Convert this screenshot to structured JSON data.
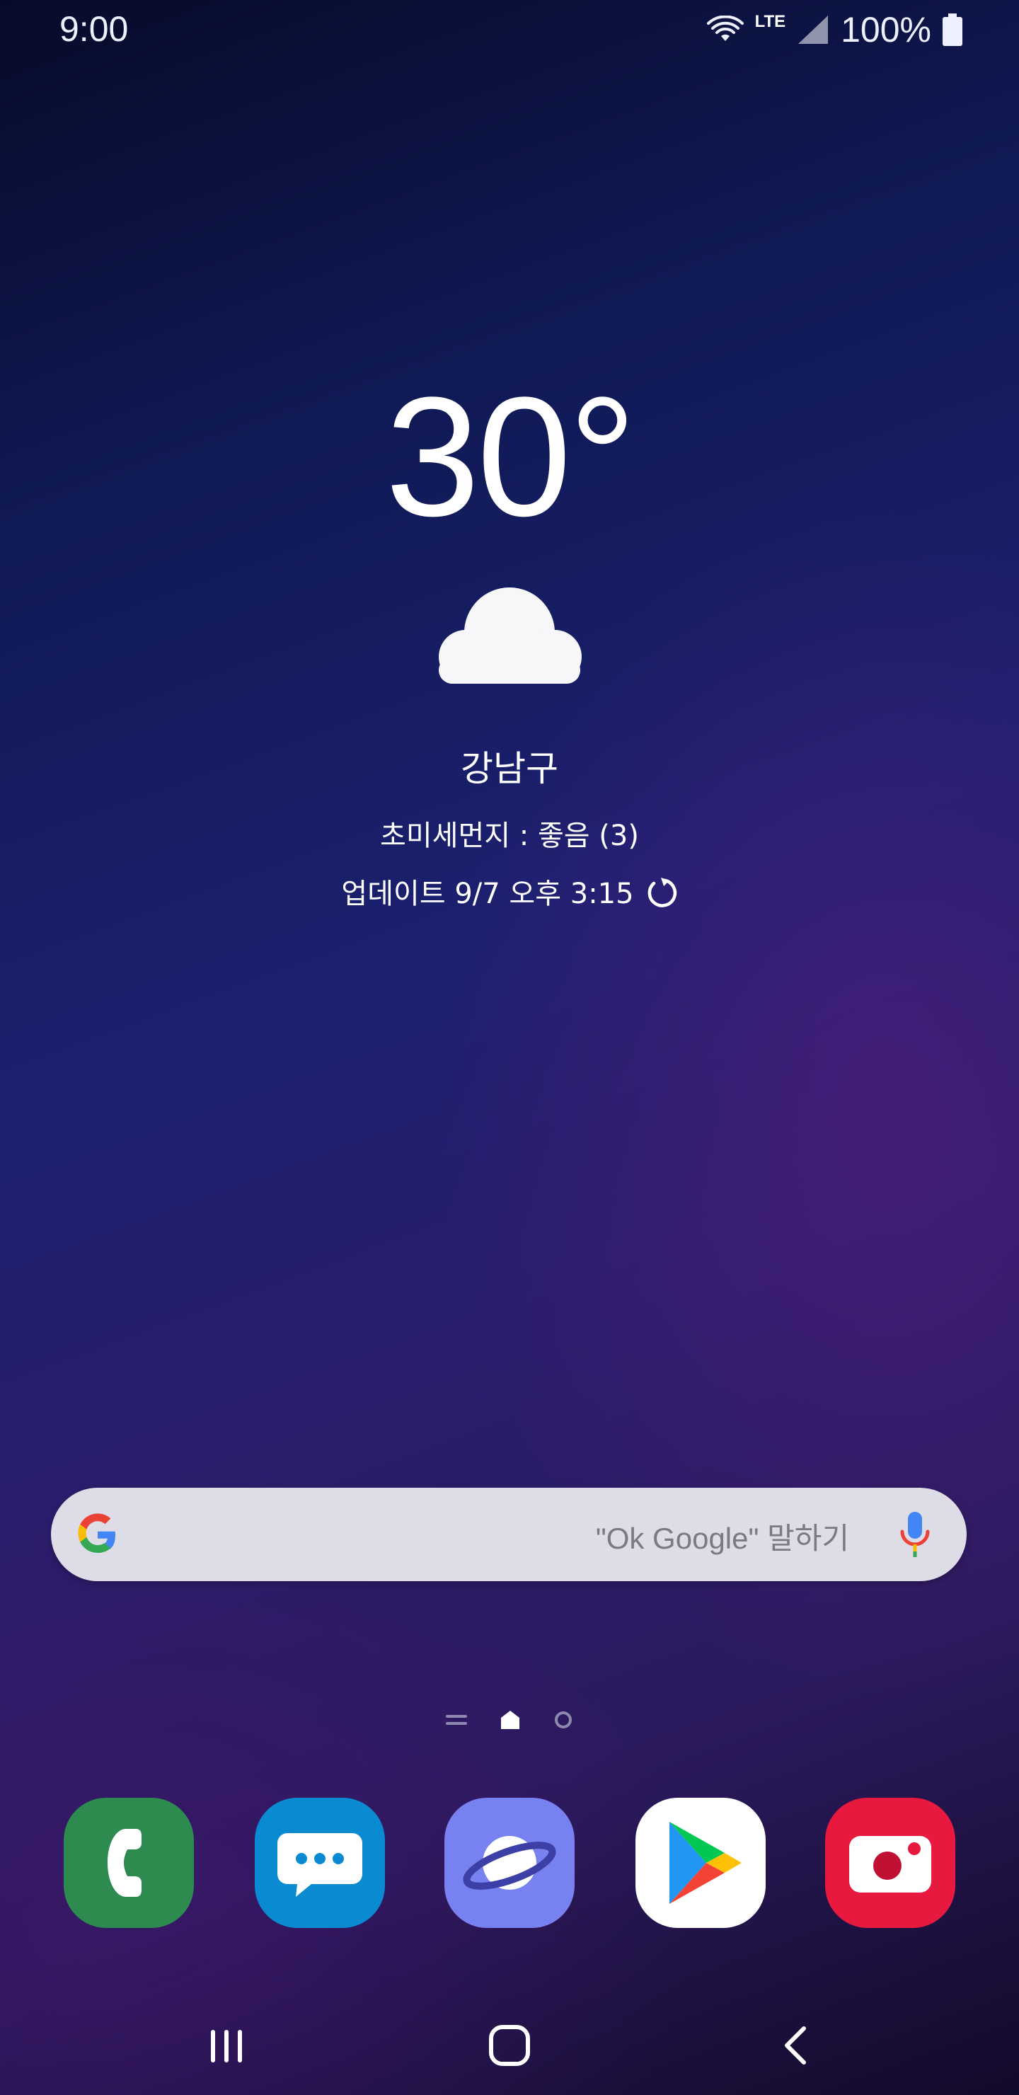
{
  "status_bar": {
    "time": "9:00",
    "network": "LTE",
    "battery_percent": "100%",
    "icons": [
      "wifi-icon",
      "cell-signal-icon",
      "battery-icon"
    ]
  },
  "weather": {
    "temperature": "30°",
    "condition_icon": "cloud-icon",
    "location": "강남구",
    "fine_dust": "초미세먼지 : 좋음 (3)",
    "updated": "업데이트 9/7 오후 3:15"
  },
  "search_bar": {
    "hint": "\"Ok Google\" 말하기"
  },
  "page_indicator": {
    "items": [
      "menu-lines-icon",
      "home-page-icon",
      "page-dot-icon"
    ],
    "active_index": 1
  },
  "dock": {
    "apps": [
      {
        "name": "phone",
        "icon": "phone-icon",
        "color": "#2e8b4f"
      },
      {
        "name": "messages",
        "icon": "messages-icon",
        "color": "#0a8ad1"
      },
      {
        "name": "internet",
        "icon": "internet-planet-icon",
        "color": "#7881f0"
      },
      {
        "name": "play-store",
        "icon": "play-store-icon",
        "color": "#ffffff"
      },
      {
        "name": "camera",
        "icon": "camera-icon",
        "color": "#e8193f"
      }
    ]
  },
  "nav_bar": {
    "buttons": [
      "recent-apps-icon",
      "home-icon",
      "back-icon"
    ]
  },
  "colors": {
    "background_top": "#070b2a",
    "background_mid": "#1c2070",
    "background_purple": "#2c1a5e",
    "search_bar": "#dedce6"
  }
}
